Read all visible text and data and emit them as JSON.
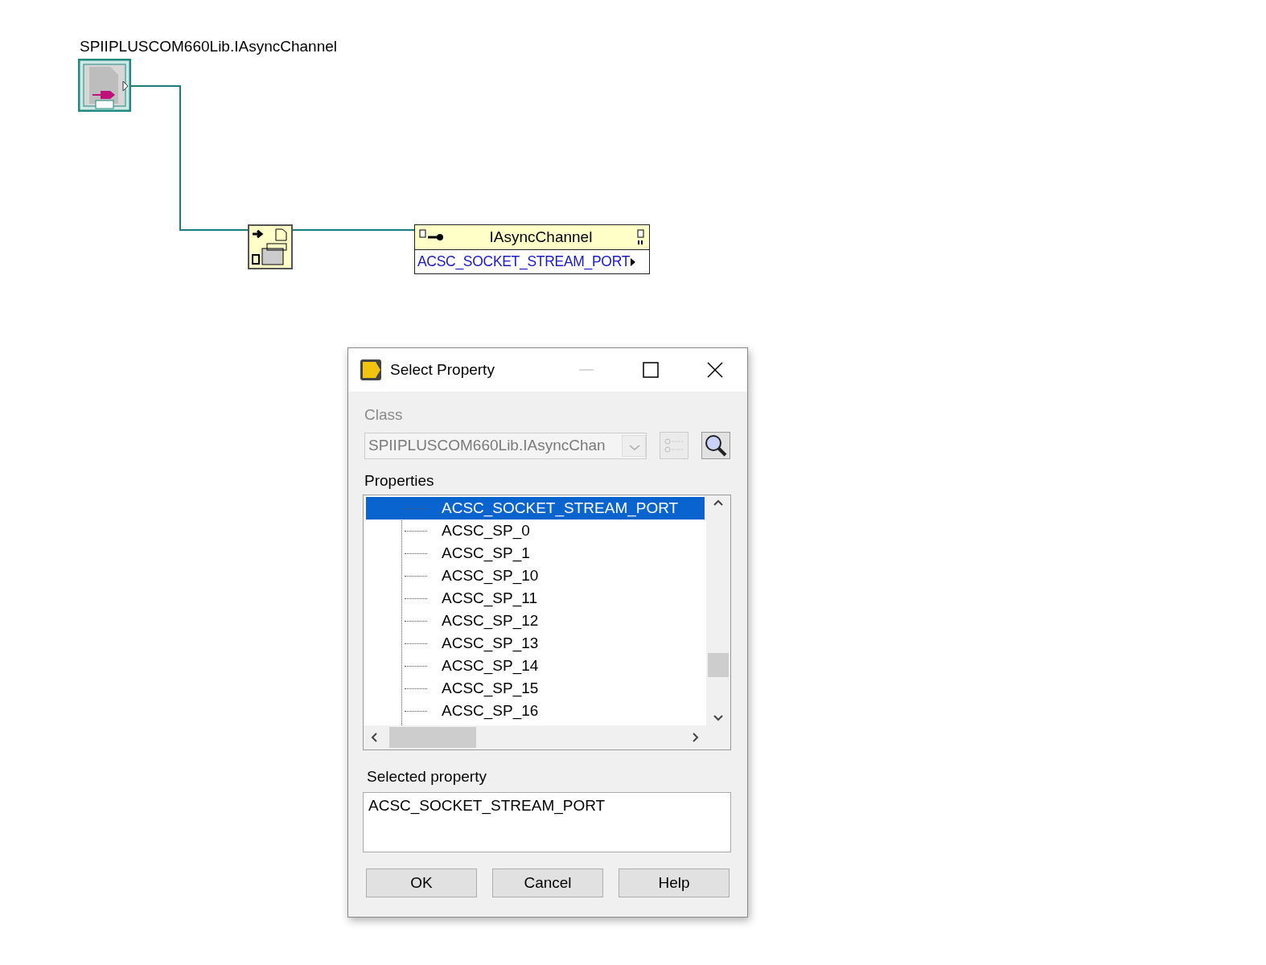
{
  "diagram": {
    "constant_label": "SPIIPLUSCOM660Lib.IAsyncChannel",
    "property_node": {
      "class_name": "IAsyncChannel",
      "property": "ACSC_SOCKET_STREAM_PORT"
    }
  },
  "dialog": {
    "title": "Select Property",
    "class_label": "Class",
    "class_value": "SPIIPLUSCOM660Lib.IAsyncChan",
    "properties_label": "Properties",
    "properties": [
      {
        "label": "ACSC_SOCKET_STREAM_PORT",
        "selected": true
      },
      {
        "label": "ACSC_SP_0",
        "selected": false
      },
      {
        "label": "ACSC_SP_1",
        "selected": false
      },
      {
        "label": "ACSC_SP_10",
        "selected": false
      },
      {
        "label": "ACSC_SP_11",
        "selected": false
      },
      {
        "label": "ACSC_SP_12",
        "selected": false
      },
      {
        "label": "ACSC_SP_13",
        "selected": false
      },
      {
        "label": "ACSC_SP_14",
        "selected": false
      },
      {
        "label": "ACSC_SP_15",
        "selected": false
      },
      {
        "label": "ACSC_SP_16",
        "selected": false
      }
    ],
    "selected_property_label": "Selected property",
    "selected_property_value": "ACSC_SOCKET_STREAM_PORT",
    "buttons": [
      "OK",
      "Cancel",
      "Help"
    ]
  }
}
